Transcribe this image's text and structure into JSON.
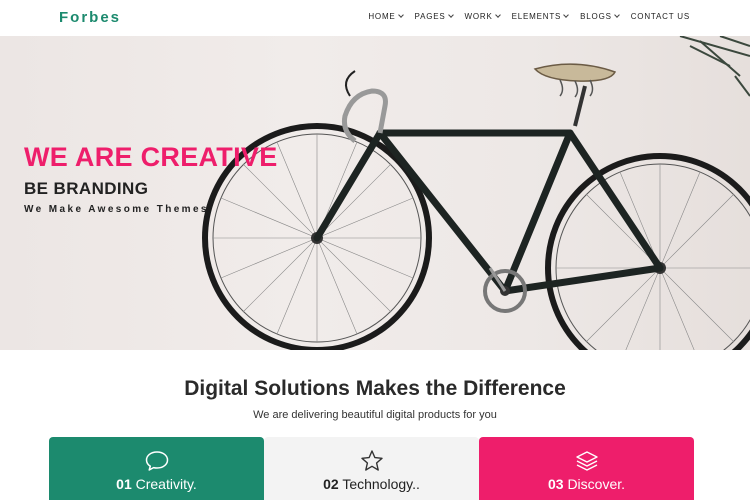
{
  "header": {
    "logo": "Forbes",
    "nav": [
      {
        "label": "HOME",
        "has_dropdown": true
      },
      {
        "label": "PAGES",
        "has_dropdown": true
      },
      {
        "label": "WORK",
        "has_dropdown": true
      },
      {
        "label": "ELEMENTS",
        "has_dropdown": true
      },
      {
        "label": "BLOGS",
        "has_dropdown": true
      },
      {
        "label": "CONTACT US",
        "has_dropdown": false
      }
    ]
  },
  "hero": {
    "title": "WE ARE CREATIVE",
    "subtitle": "BE BRANDING",
    "tagline": "We Make Awesome Themes"
  },
  "section": {
    "title": "Digital Solutions Makes the Difference",
    "subtitle": "We are delivering beautiful digital products for you"
  },
  "cards": [
    {
      "number": "01",
      "label": "Creativity.",
      "icon": "chat-bubble-icon"
    },
    {
      "number": "02",
      "label": "Technology..",
      "icon": "star-icon"
    },
    {
      "number": "03",
      "label": "Discover.",
      "icon": "layers-icon"
    }
  ],
  "colors": {
    "brand_green": "#1c8a6e",
    "accent_pink": "#ee1e6b",
    "card_gray": "#f3f3f3",
    "text_dark": "#222222"
  }
}
